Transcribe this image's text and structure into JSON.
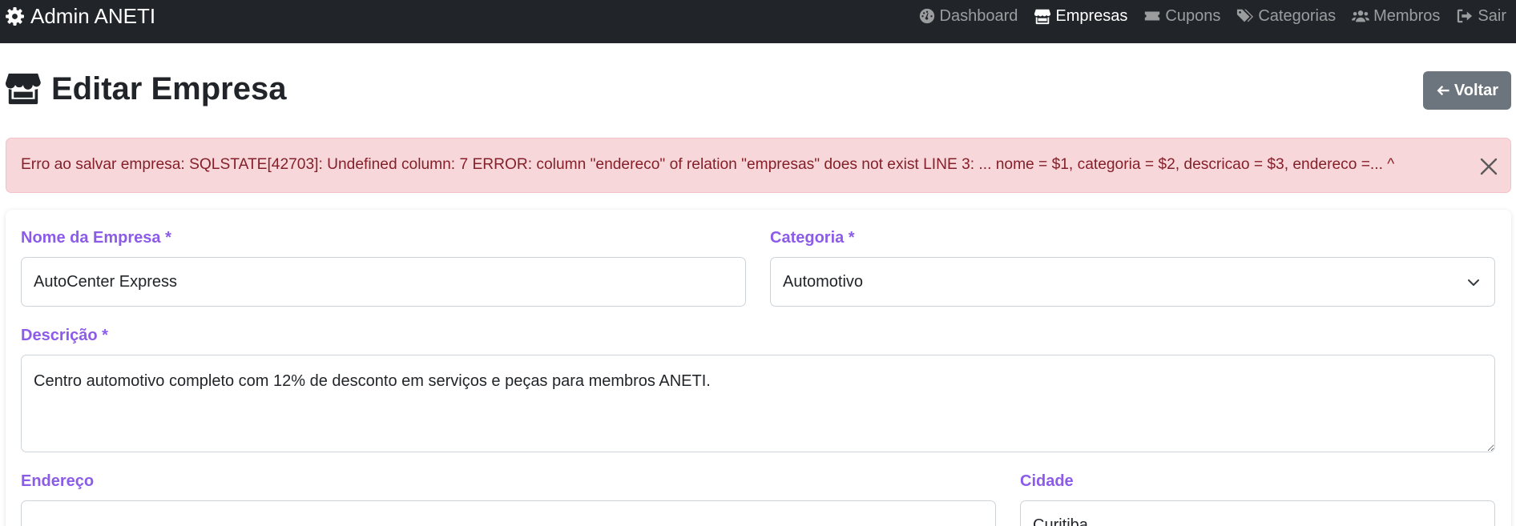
{
  "navbar": {
    "brand": "Admin ANETI",
    "brand_icon": "gear-icon",
    "items": [
      {
        "label": "Dashboard",
        "icon": "tachometer-icon",
        "active": false
      },
      {
        "label": "Empresas",
        "icon": "store-icon",
        "active": true
      },
      {
        "label": "Cupons",
        "icon": "ticket-icon",
        "active": false
      },
      {
        "label": "Categorias",
        "icon": "tags-icon",
        "active": false
      },
      {
        "label": "Membros",
        "icon": "users-icon",
        "active": false
      },
      {
        "label": "Sair",
        "icon": "sign-out-icon",
        "active": false
      }
    ]
  },
  "header": {
    "title": "Editar Empresa",
    "title_icon": "store-icon",
    "back_label": "Voltar",
    "back_icon": "arrow-left-icon"
  },
  "alert": {
    "message": "Erro ao salvar empresa: SQLSTATE[42703]: Undefined column: 7 ERROR: column \"endereco\" of relation \"empresas\" does not exist LINE 3: ... nome = $1, categoria = $2, descricao = $3, endereco =... ^",
    "close_icon": "close-icon"
  },
  "form": {
    "nome": {
      "label": "Nome da Empresa *",
      "value": "AutoCenter Express"
    },
    "categoria": {
      "label": "Categoria *",
      "value": "Automotivo"
    },
    "descricao": {
      "label": "Descrição *",
      "value": "Centro automotivo completo com 12% de desconto em serviços e peças para membros ANETI."
    },
    "endereco": {
      "label": "Endereço",
      "value": ""
    },
    "cidade": {
      "label": "Cidade",
      "value": "Curitiba"
    }
  },
  "colors": {
    "navbar_bg": "#212529",
    "label_color": "#8c5ce8",
    "alert_bg": "#f8d7da",
    "alert_text": "#842029",
    "back_button_bg": "#6c757d"
  }
}
